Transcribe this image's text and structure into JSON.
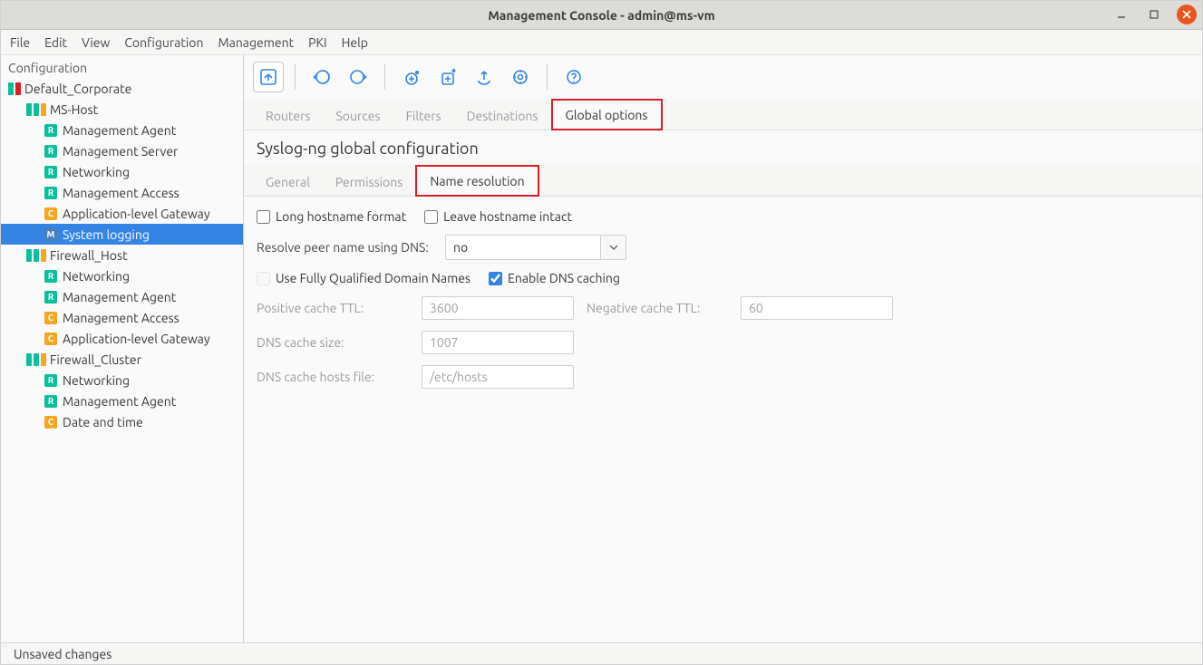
{
  "window": {
    "title": "Management Console - admin@ms-vm"
  },
  "menubar": [
    "File",
    "Edit",
    "View",
    "Configuration",
    "Management",
    "PKI",
    "Help"
  ],
  "sidebar": {
    "title": "Configuration",
    "tree": [
      {
        "depth": 0,
        "kind": "site",
        "label": "Default_Corporate",
        "colors": [
          "#0abf9c",
          "#e01b24"
        ]
      },
      {
        "depth": 1,
        "kind": "host",
        "label": "MS-Host",
        "colors": [
          "#0abf9c",
          "#0abf9c",
          "#f5a623"
        ]
      },
      {
        "depth": 2,
        "kind": "comp",
        "badge": "R",
        "label": "Management Agent"
      },
      {
        "depth": 2,
        "kind": "comp",
        "badge": "R",
        "label": "Management Server"
      },
      {
        "depth": 2,
        "kind": "comp",
        "badge": "R",
        "label": "Networking"
      },
      {
        "depth": 2,
        "kind": "comp",
        "badge": "R",
        "label": "Management Access"
      },
      {
        "depth": 2,
        "kind": "comp",
        "badge": "C",
        "label": "Application-level Gateway"
      },
      {
        "depth": 2,
        "kind": "comp",
        "badge": "M",
        "label": "System logging",
        "selected": true
      },
      {
        "depth": 1,
        "kind": "host",
        "label": "Firewall_Host",
        "colors": [
          "#0abf9c",
          "#0abf9c",
          "#f5a623"
        ]
      },
      {
        "depth": 2,
        "kind": "comp",
        "badge": "R",
        "label": "Networking"
      },
      {
        "depth": 2,
        "kind": "comp",
        "badge": "R",
        "label": "Management Agent"
      },
      {
        "depth": 2,
        "kind": "comp",
        "badge": "C",
        "label": "Management Access"
      },
      {
        "depth": 2,
        "kind": "comp",
        "badge": "C",
        "label": "Application-level Gateway"
      },
      {
        "depth": 1,
        "kind": "host",
        "label": "Firewall_Cluster",
        "colors": [
          "#0abf9c",
          "#0abf9c",
          "#f5a623"
        ]
      },
      {
        "depth": 2,
        "kind": "comp",
        "badge": "R",
        "label": "Networking"
      },
      {
        "depth": 2,
        "kind": "comp",
        "badge": "R",
        "label": "Management Agent"
      },
      {
        "depth": 2,
        "kind": "comp",
        "badge": "C",
        "label": "Date and time"
      }
    ]
  },
  "toolbar": {
    "icons": [
      "up-level-icon",
      "commit-icon",
      "revert-icon",
      "new-source-icon",
      "new-destination-icon",
      "upload-icon",
      "gear-cycle-icon",
      "help-cycle-icon"
    ]
  },
  "tabs1": [
    {
      "label": "Routers"
    },
    {
      "label": "Sources"
    },
    {
      "label": "Filters"
    },
    {
      "label": "Destinations"
    },
    {
      "label": "Global options",
      "active": true,
      "highlight": true
    }
  ],
  "heading": "Syslog-ng global configuration",
  "tabs2": [
    {
      "label": "General"
    },
    {
      "label": "Permissions"
    },
    {
      "label": "Name resolution",
      "active": true,
      "highlight": true
    }
  ],
  "form": {
    "long_hostname": {
      "label": "Long hostname format",
      "checked": false
    },
    "leave_hostname": {
      "label": "Leave hostname intact",
      "checked": false
    },
    "resolve_label": "Resolve peer name using DNS:",
    "resolve_value": "no",
    "use_fqdn": {
      "label": "Use Fully Qualified Domain Names",
      "checked": false,
      "disabled": true
    },
    "enable_cache": {
      "label": "Enable DNS caching",
      "checked": true
    },
    "pos_ttl": {
      "label": "Positive cache TTL:",
      "value": "3600"
    },
    "neg_ttl": {
      "label": "Negative cache TTL:",
      "value": "60"
    },
    "cache_size": {
      "label": "DNS cache size:",
      "value": "1007"
    },
    "hosts_file": {
      "label": "DNS cache hosts file:",
      "value": "/etc/hosts"
    }
  },
  "status": "Unsaved changes"
}
